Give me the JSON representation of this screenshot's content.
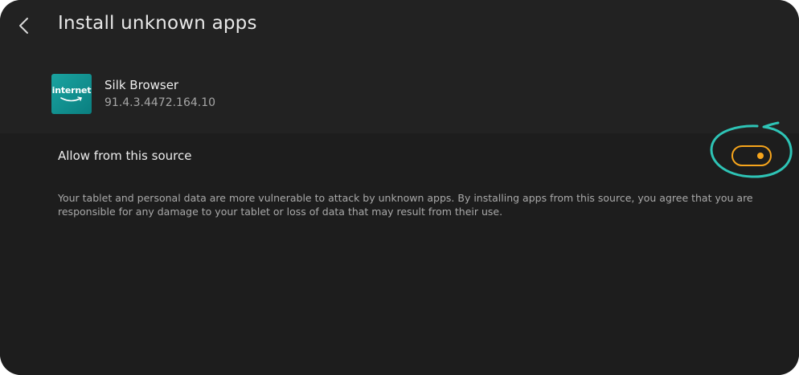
{
  "header": {
    "title": "Install unknown apps",
    "back_icon": "chevron-left-icon"
  },
  "app": {
    "icon_text": "internet",
    "name": "Silk Browser",
    "version": "91.4.3.4472.164.10"
  },
  "setting": {
    "label": "Allow from this source",
    "toggle_state": "on",
    "accent_color": "#f7a51c",
    "highlight_color": "#2ec4b6",
    "description": "Your tablet and personal data are more vulnerable to attack by unknown apps. By installing apps from this source, you agree that you are responsible for any damage to your tablet or loss of data that may result from their use."
  }
}
